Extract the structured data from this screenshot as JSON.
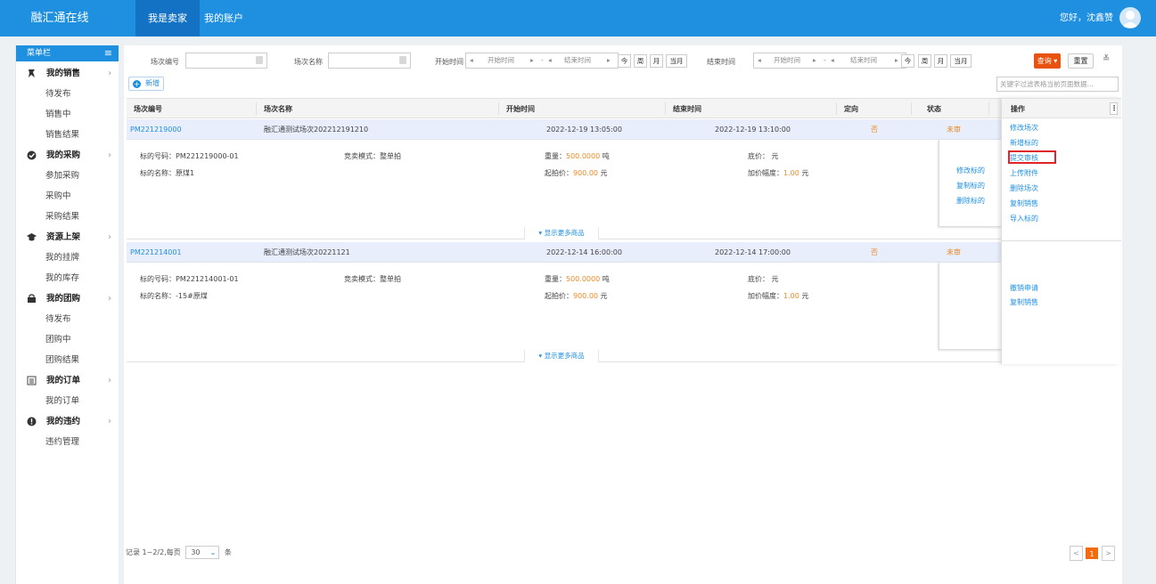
{
  "top": {
    "brand": "融汇通在线",
    "nav": [
      "我是卖家",
      "我的账户"
    ],
    "greeting": "您好，沈鑫赞"
  },
  "sidebar": {
    "title": "菜单栏",
    "sections": [
      {
        "label": "我的销售",
        "icon": "seller-icon",
        "items": [
          "待发布",
          "销售中",
          "销售结果"
        ]
      },
      {
        "label": "我的采购",
        "icon": "check-circle-icon",
        "items": [
          "参加采购",
          "采购中",
          "采购结果"
        ]
      },
      {
        "label": "资源上架",
        "icon": "graduation-cap-icon",
        "items": [
          "我的挂牌",
          "我的库存"
        ]
      },
      {
        "label": "我的团购",
        "icon": "group-buy-icon",
        "items": [
          "待发布",
          "团购中",
          "团购结果"
        ]
      },
      {
        "label": "我的订单",
        "icon": "order-list-icon",
        "items": [
          "我的订单"
        ]
      },
      {
        "label": "我的违约",
        "icon": "exclamation-icon",
        "items": [
          "违约管理"
        ]
      }
    ]
  },
  "filters": {
    "session_no_label": "场次编号",
    "session_name_label": "场次名称",
    "start_time_label": "开始时间",
    "end_time_label": "结束时间",
    "range_start": "开始时间",
    "range_sep": "-",
    "range_end": "结束时间",
    "quick": [
      "今",
      "周",
      "月",
      "当月"
    ],
    "query": "查询",
    "reset": "重置"
  },
  "toolbar": {
    "add": "新增",
    "keyword_placeholder": "关键字过滤表格当前页面数据..."
  },
  "table": {
    "headers": [
      "场次编号",
      "场次名称",
      "开始时间",
      "结束时间",
      "定向",
      "状态"
    ],
    "ops_header": "操作",
    "rows": [
      {
        "no": "PM221219000",
        "name": "融汇通测试场次202212191210",
        "start": "2022-12-19 13:05:00",
        "end": "2022-12-19 13:10:00",
        "directed": "否",
        "status": "未审",
        "item_no": "标的号码：PM221219000-01",
        "mode": "竞卖模式：整单拍",
        "weight_label": "重量：",
        "weight": "500.0000",
        "weight_unit": "吨",
        "floor": "底价：  元",
        "item_name": "标的名称：原煤1",
        "start_price_label": "起拍价：",
        "start_price": "900.00",
        "price_unit": "元",
        "increment_label": "加价幅度：",
        "increment": "1.00",
        "sub_ops": [
          "修改标的",
          "复制标的",
          "删除标的"
        ],
        "ops": [
          "修改场次",
          "新增标的",
          "提交审核",
          "上传附件",
          "删除场次",
          "复制销售",
          "导入标的"
        ]
      },
      {
        "no": "PM221214001",
        "name": "融汇通测试场次20221121",
        "start": "2022-12-14 16:00:00",
        "end": "2022-12-14 17:00:00",
        "directed": "否",
        "status": "未审",
        "item_no": "标的号码：PM221214001-01",
        "mode": "竞卖模式：整单拍",
        "weight_label": "重量：",
        "weight": "500.0000",
        "weight_unit": "吨",
        "floor": "底价：  元",
        "item_name": "标的名称：-15#原煤",
        "start_price_label": "起拍价：",
        "start_price": "900.00",
        "price_unit": "元",
        "increment_label": "加价幅度：",
        "increment": "1.00",
        "sub_ops": [],
        "ops": [
          "撤销申请",
          "复制销售"
        ]
      }
    ],
    "show_more": "显示更多商品"
  },
  "footer": {
    "record_text": "记录 1~2/2,每页",
    "page_size": "30",
    "unit": "条",
    "prev": "<",
    "current_page": "1",
    "next": ">"
  },
  "colors": {
    "primary": "#1f8fe0",
    "query_button": "#e8510e",
    "highlight_box": "#e0252a",
    "status_orange": "#e98b27"
  }
}
